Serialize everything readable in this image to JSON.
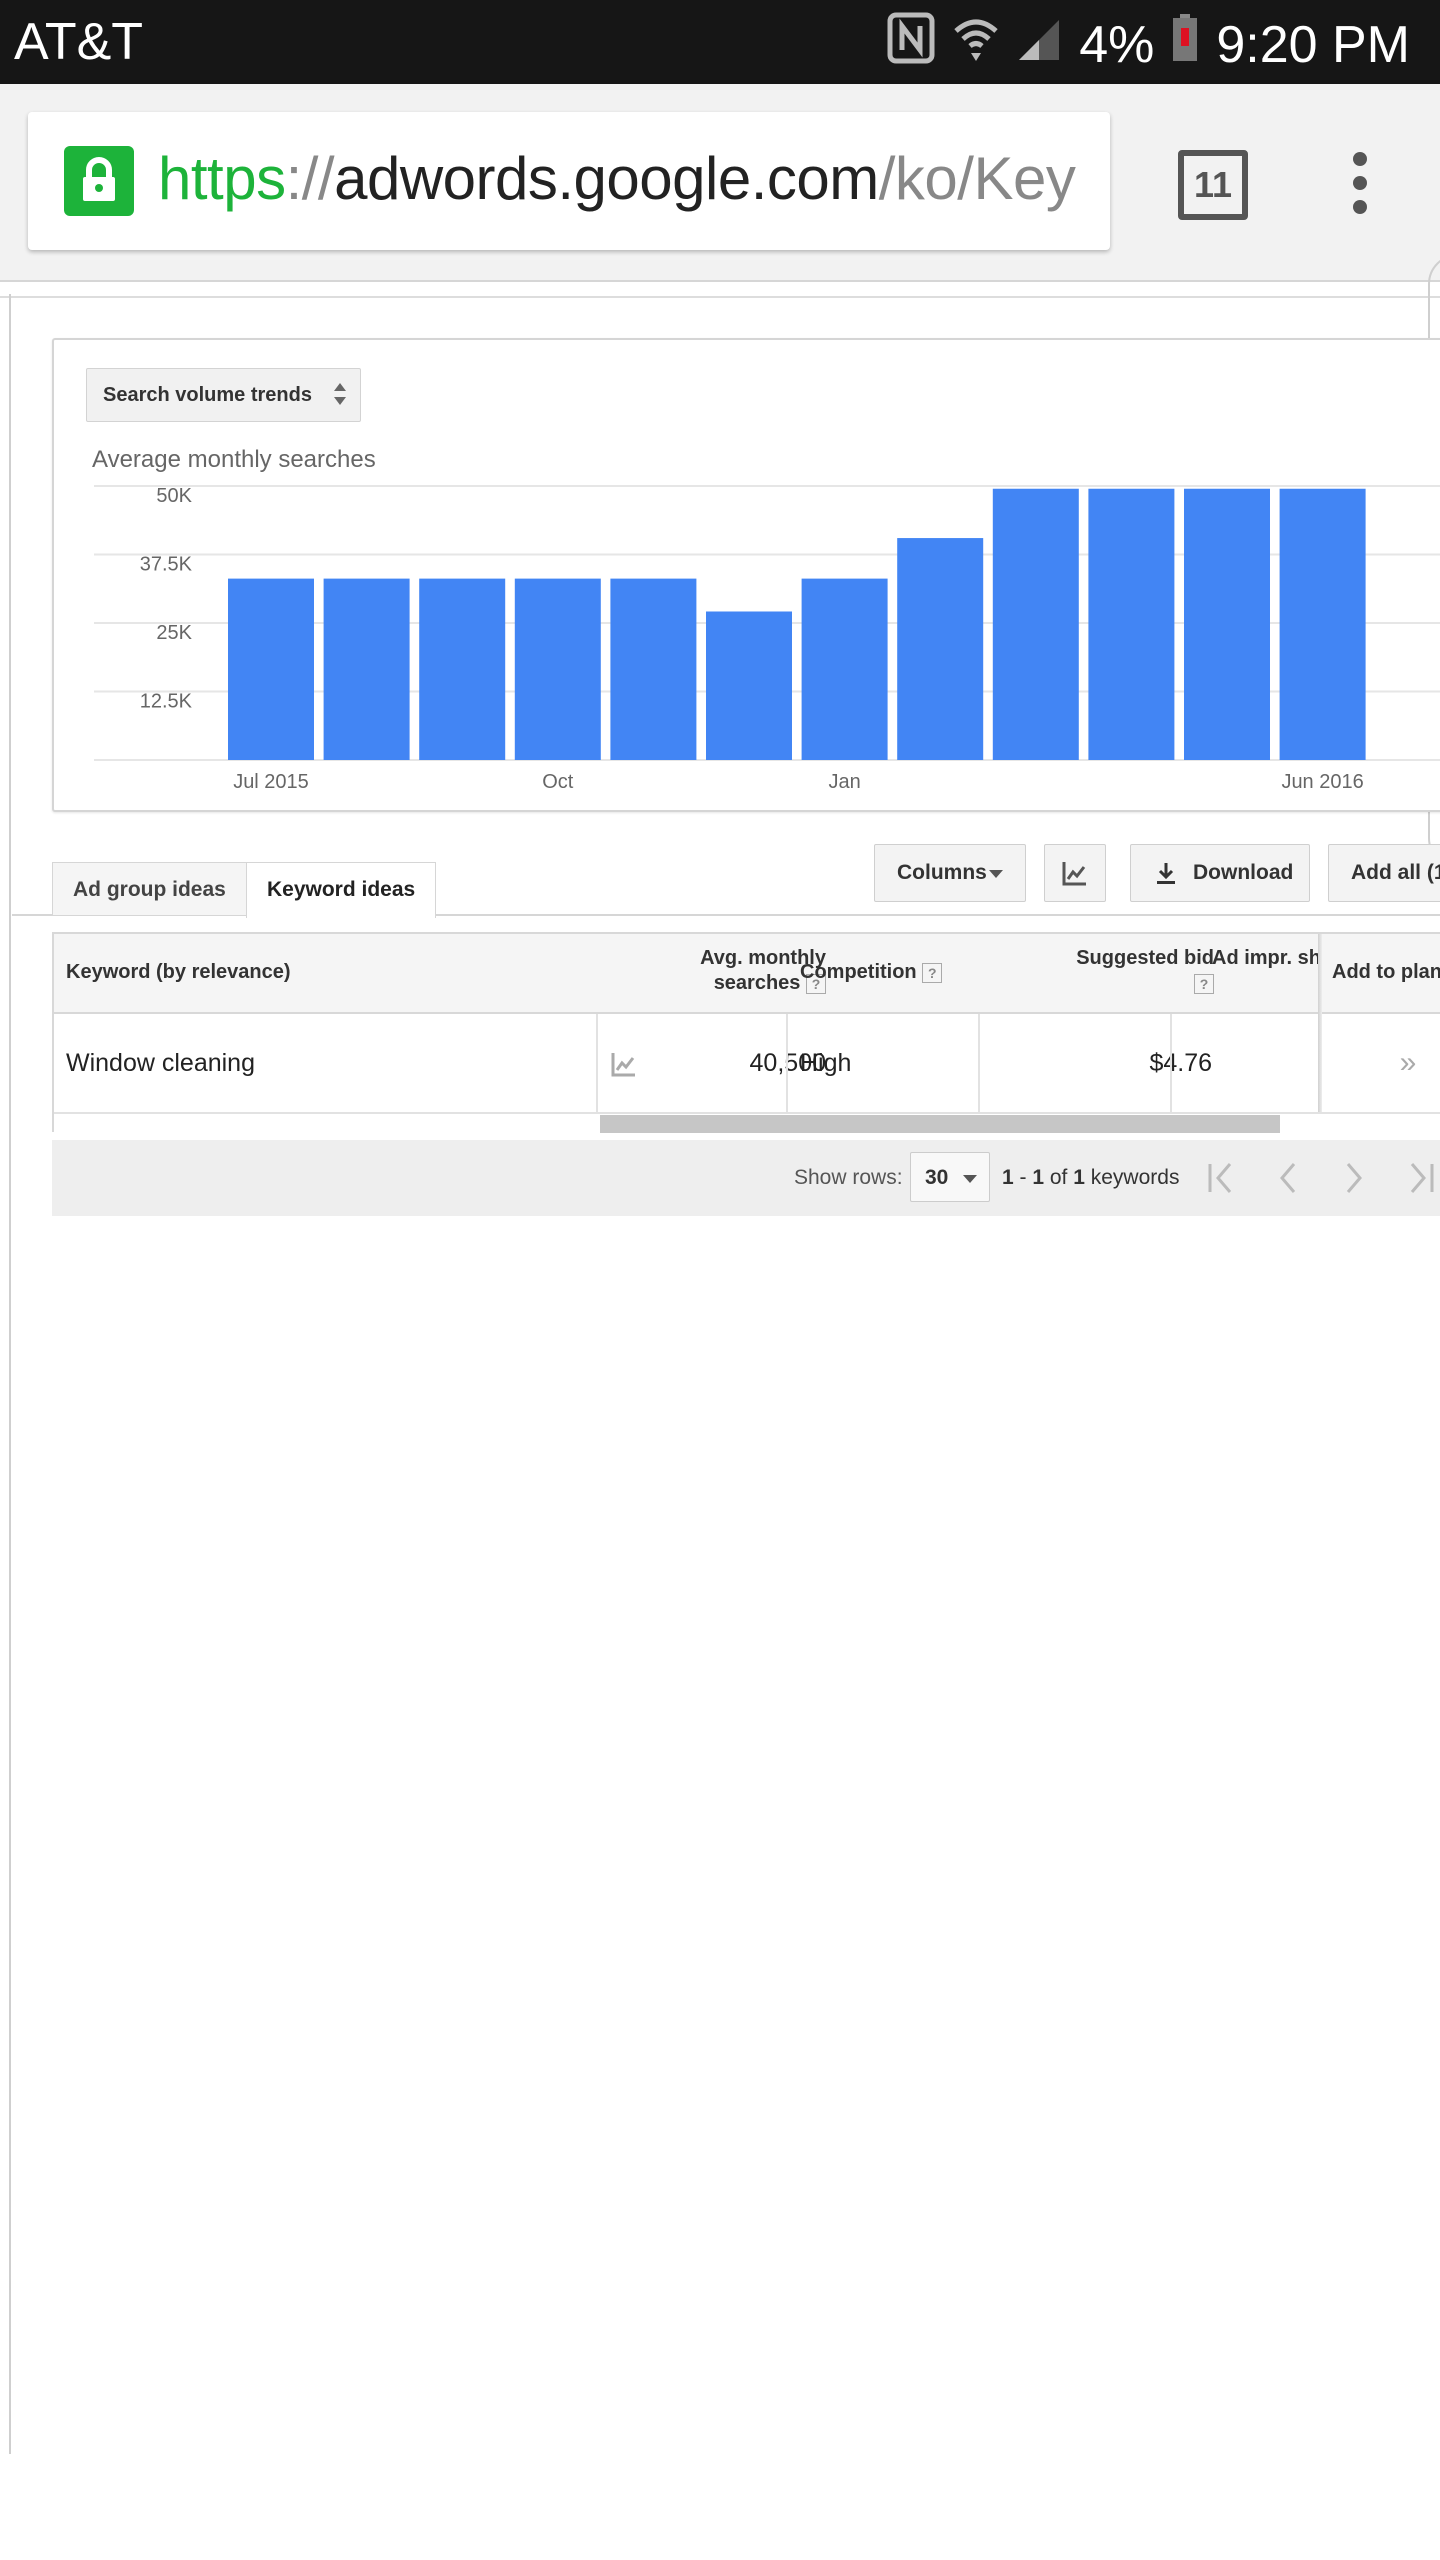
{
  "status_bar": {
    "carrier": "AT&T",
    "battery": "4%",
    "time": "9:20 PM"
  },
  "browser": {
    "url_scheme": "https",
    "url_sep": "://",
    "url_host": "adwords.google.com",
    "url_path": "/ko/Key",
    "tab_count": "11"
  },
  "chart_panel": {
    "selector_label": "Search volume trends",
    "title": "Average monthly searches"
  },
  "chart_data": {
    "type": "bar",
    "title": "Average monthly searches",
    "xlabel": "",
    "ylabel": "",
    "ylim": [
      0,
      50000
    ],
    "y_ticks": [
      12500,
      25000,
      37500,
      50000
    ],
    "y_tick_labels": [
      "12.5K",
      "25K",
      "37.5K",
      "50K"
    ],
    "x_tick_labels": [
      "Jul 2015",
      "Oct",
      "Jan",
      "Jun 2016"
    ],
    "x_tick_indices": [
      0,
      3,
      6,
      11
    ],
    "categories": [
      "Jul 2015",
      "Aug 2015",
      "Sep 2015",
      "Oct 2015",
      "Nov 2015",
      "Dec 2015",
      "Jan 2016",
      "Feb 2016",
      "Mar 2016",
      "Apr 2016",
      "May 2016",
      "Jun 2016"
    ],
    "values": [
      33100,
      33100,
      33100,
      33100,
      33100,
      27100,
      33100,
      40500,
      49500,
      49500,
      49500,
      49500
    ],
    "grid": true,
    "bar_color": "#4285f4"
  },
  "tabs": {
    "ad_group_ideas": "Ad group ideas",
    "keyword_ideas": "Keyword ideas"
  },
  "toolbar": {
    "columns": "Columns",
    "download": "Download",
    "add_all": "Add all (1"
  },
  "table": {
    "headers": {
      "keyword": "Keyword (by relevance)",
      "avg_line1": "Avg. monthly",
      "avg_line2": "searches",
      "competition": "Competition",
      "bid_line1": "Suggested bid",
      "ad_impr": "Ad impr. sh",
      "add_to_plan": "Add to plan"
    },
    "rows": [
      {
        "keyword": "Window cleaning",
        "avg_searches": "40,500",
        "competition": "High",
        "suggested_bid": "$4.76",
        "ad_impr_share": "",
        "add": "»"
      }
    ]
  },
  "pager": {
    "show_rows_label": "Show rows:",
    "rows_value": "30",
    "range_start": "1",
    "range_dash": " - ",
    "range_end": "1",
    "of_word": " of ",
    "total": "1",
    "unit": " keywords"
  }
}
